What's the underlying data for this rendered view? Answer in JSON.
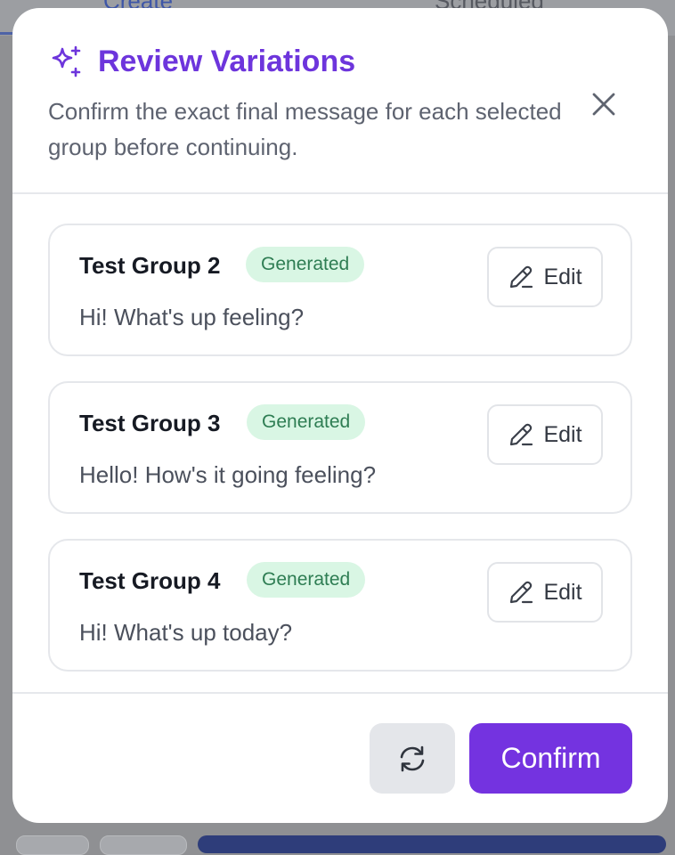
{
  "background": {
    "tabs": [
      {
        "label": "Create"
      },
      {
        "label": "Scheduled"
      }
    ]
  },
  "modal": {
    "title": "Review Variations",
    "subtitle": "Confirm the exact final message for each selected group before continuing.",
    "accent_color": "#6d35dc",
    "cards": [
      {
        "title": "Test Group 2",
        "badge": "Generated",
        "message": "Hi! What's up feeling?",
        "edit_label": "Edit"
      },
      {
        "title": "Test Group 3",
        "badge": "Generated",
        "message": "Hello! How's it going feeling?",
        "edit_label": "Edit"
      },
      {
        "title": "Test Group 4",
        "badge": "Generated",
        "message": "Hi! What's up today?",
        "edit_label": "Edit"
      }
    ],
    "footer": {
      "refresh_icon": "refresh-icon",
      "confirm_label": "Confirm"
    }
  },
  "icons": {
    "title": "sparkles-icon",
    "close": "close-icon",
    "edit": "pencil-icon"
  },
  "colors": {
    "badge_bg": "#d9f6e4",
    "badge_text": "#2e7d53",
    "confirm_bg": "#7433e0"
  }
}
